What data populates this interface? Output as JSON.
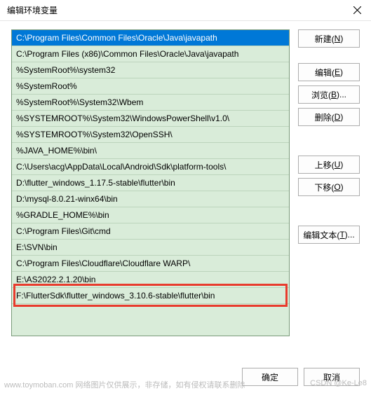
{
  "window": {
    "title": "编辑环境变量"
  },
  "path_entries": [
    "C:\\Program Files\\Common Files\\Oracle\\Java\\javapath",
    "C:\\Program Files (x86)\\Common Files\\Oracle\\Java\\javapath",
    "%SystemRoot%\\system32",
    "%SystemRoot%",
    "%SystemRoot%\\System32\\Wbem",
    "%SYSTEMROOT%\\System32\\WindowsPowerShell\\v1.0\\",
    "%SYSTEMROOT%\\System32\\OpenSSH\\",
    "%JAVA_HOME%\\bin\\",
    "C:\\Users\\acg\\AppData\\Local\\Android\\Sdk\\platform-tools\\",
    "D:\\flutter_windows_1.17.5-stable\\flutter\\bin",
    "D:\\mysql-8.0.21-winx64\\bin",
    "%GRADLE_HOME%\\bin",
    "C:\\Program Files\\Git\\cmd",
    "E:\\SVN\\bin",
    "C:\\Program Files\\Cloudflare\\Cloudflare WARP\\",
    "E:\\AS2022.2.1.20\\bin",
    "F:\\FlutterSdk\\flutter_windows_3.10.6-stable\\flutter\\bin"
  ],
  "selected_index": 0,
  "highlight_index": 16,
  "buttons": {
    "new_": {
      "text": "新建(",
      "mnemonic": "N",
      "suffix": ")"
    },
    "edit": {
      "text": "编辑(",
      "mnemonic": "E",
      "suffix": ")"
    },
    "browse": {
      "text": "浏览(",
      "mnemonic": "B",
      "suffix": ")..."
    },
    "delete_": {
      "text": "删除(",
      "mnemonic": "D",
      "suffix": ")"
    },
    "move_up": {
      "text": "上移(",
      "mnemonic": "U",
      "suffix": ")"
    },
    "move_down": {
      "text": "下移(",
      "mnemonic": "O",
      "suffix": ")"
    },
    "edit_text": {
      "text": "编辑文本(",
      "mnemonic": "T",
      "suffix": ")..."
    },
    "ok": "确定",
    "cancel": "取消"
  },
  "watermark": {
    "left": "www.toymoban.com  网络图片仅供展示，非存储，如有侵权请联系删除",
    "right": "CSDN @Ke-Le8"
  }
}
